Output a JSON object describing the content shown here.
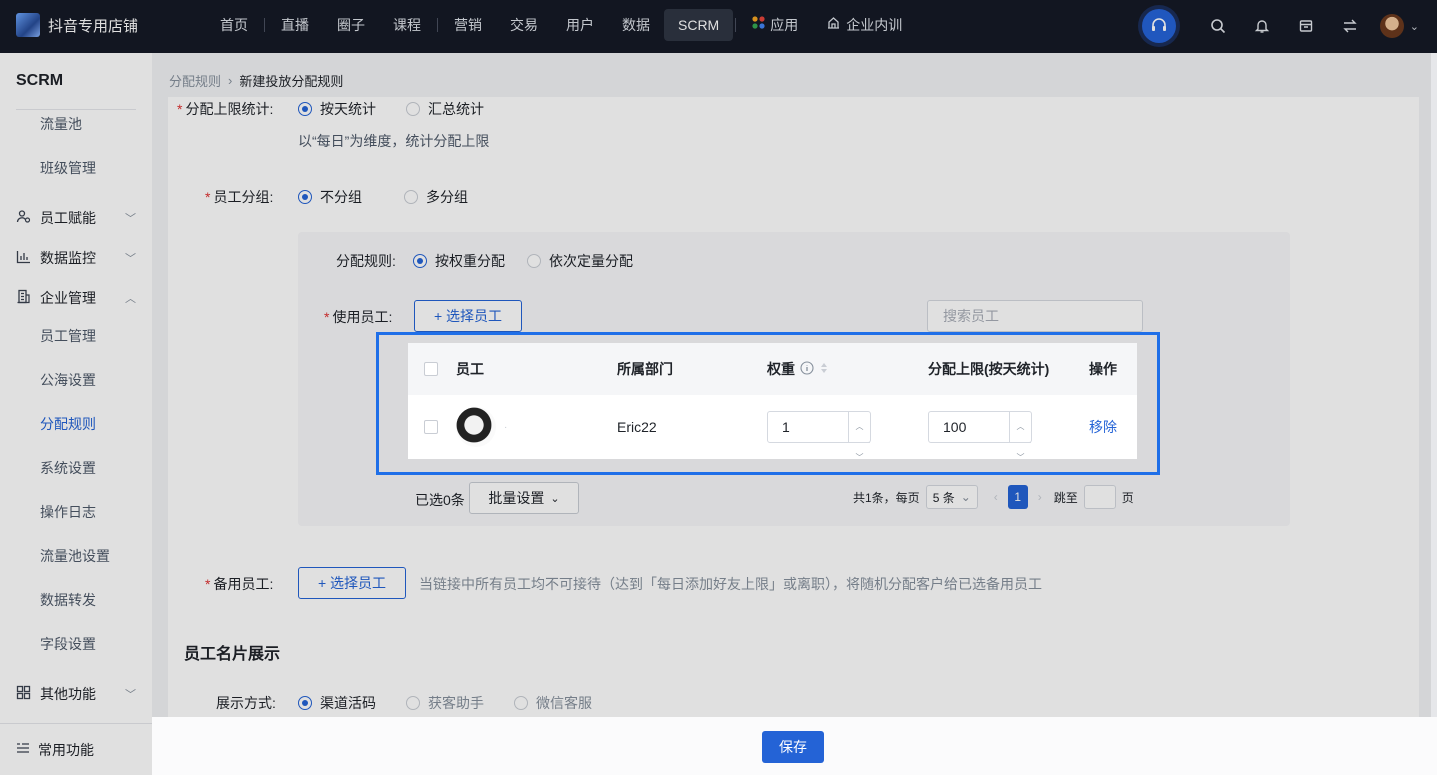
{
  "header": {
    "store_name": "抖音专用店铺",
    "nav": [
      "首页",
      "直播",
      "圈子",
      "课程",
      "营销",
      "交易",
      "用户",
      "数据",
      "SCRM",
      "应用",
      "企业内训"
    ],
    "active_nav": "SCRM"
  },
  "sidebar": {
    "title": "SCRM",
    "items": [
      "流量池",
      "班级管理"
    ],
    "groups": [
      "员工赋能",
      "数据监控",
      "企业管理"
    ],
    "sub_items": [
      "员工管理",
      "公海设置",
      "分配规则",
      "系统设置",
      "操作日志",
      "流量池设置",
      "数据转发",
      "字段设置"
    ],
    "other_group": "其他功能",
    "bottom": "常用功能"
  },
  "breadcrumb": {
    "parent": "分配规则",
    "separator": "›",
    "current": "新建投放分配规则"
  },
  "form": {
    "limit_stat": {
      "label": "分配上限统计:",
      "options": [
        "按天统计",
        "汇总统计"
      ],
      "selected": "按天统计",
      "hint": "以“每日”为维度，统计分配上限"
    },
    "grouping": {
      "label": "员工分组:",
      "options": [
        "不分组",
        "多分组"
      ],
      "selected": "不分组"
    },
    "rule": {
      "label": "分配规则:",
      "options": [
        "按权重分配",
        "依次定量分配"
      ],
      "selected": "按权重分配"
    },
    "use_staff": {
      "label": "使用员工:",
      "select_button": "+ 选择员工",
      "search_placeholder": "搜索员工"
    },
    "table": {
      "headers": [
        "员工",
        "所属部门",
        "权重",
        "分配上限(按天统计)",
        "操作"
      ],
      "rows": [
        {
          "name": "·",
          "department": "Eric22",
          "weight": "1",
          "limit": "100",
          "action": "移除"
        }
      ]
    },
    "batch": {
      "selected_text": "已选0条",
      "batch_button": "批量设置"
    },
    "pagination": {
      "total_text": "共1条，每页",
      "page_size": "5 条",
      "current_page": "1",
      "jump_label": "跳至",
      "page_unit": "页"
    },
    "backup_staff": {
      "label": "备用员工:",
      "select_button": "+ 选择员工",
      "hint": "当链接中所有员工均不可接待（达到「每日添加好友上限」或离职），将随机分配客户给已选备用员工"
    },
    "card_section_title": "员工名片展示",
    "display_mode": {
      "label": "展示方式:",
      "options": [
        "渠道活码",
        "获客助手",
        "微信客服"
      ],
      "selected": "渠道活码"
    }
  },
  "footer": {
    "save_label": "保存"
  },
  "colors": {
    "accent": "#2463d6",
    "highlight_border": "#1f6fe8",
    "topbar": "#151a26"
  }
}
